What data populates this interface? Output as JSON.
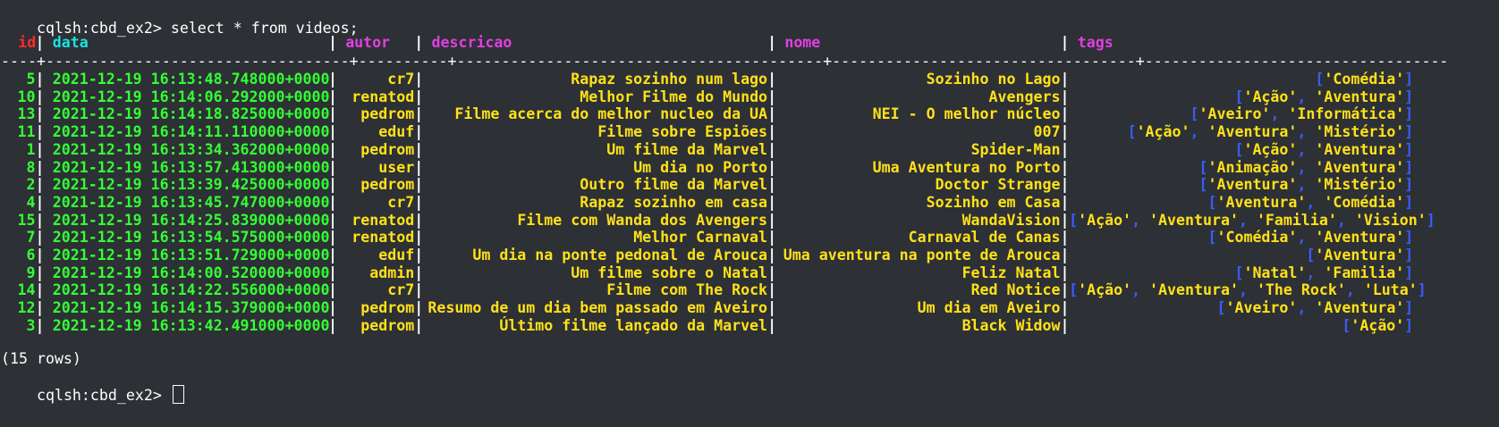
{
  "prompt": "cqlsh:cbd_ex2>",
  "command": " select * from videos;",
  "columns": [
    "id",
    "data",
    "autor",
    "descricao",
    "nome",
    "tags"
  ],
  "rows": [
    {
      "id": "5",
      "data": "2021-12-19 16:13:48.748000+0000",
      "autor": "cr7",
      "descricao": "Rapaz sozinho num lago",
      "nome": "Sozinho no Lago",
      "tags": [
        "Comédia"
      ]
    },
    {
      "id": "10",
      "data": "2021-12-19 16:14:06.292000+0000",
      "autor": "renatod",
      "descricao": "Melhor Filme do Mundo",
      "nome": "Avengers",
      "tags": [
        "Ação",
        "Aventura"
      ]
    },
    {
      "id": "13",
      "data": "2021-12-19 16:14:18.825000+0000",
      "autor": "pedrom",
      "descricao": "Filme acerca do melhor nucleo da UA",
      "nome": "NEI - O melhor núcleo",
      "tags": [
        "Aveiro",
        "Informática"
      ]
    },
    {
      "id": "11",
      "data": "2021-12-19 16:14:11.110000+0000",
      "autor": "eduf",
      "descricao": "Filme sobre Espiões",
      "nome": "007",
      "tags": [
        "Ação",
        "Aventura",
        "Mistério"
      ]
    },
    {
      "id": "1",
      "data": "2021-12-19 16:13:34.362000+0000",
      "autor": "pedrom",
      "descricao": "Um filme da Marvel",
      "nome": "Spider-Man",
      "tags": [
        "Ação",
        "Aventura"
      ]
    },
    {
      "id": "8",
      "data": "2021-12-19 16:13:57.413000+0000",
      "autor": "user",
      "descricao": "Um dia no Porto",
      "nome": "Uma Aventura no Porto",
      "tags": [
        "Animação",
        "Aventura"
      ]
    },
    {
      "id": "2",
      "data": "2021-12-19 16:13:39.425000+0000",
      "autor": "pedrom",
      "descricao": "Outro filme da Marvel",
      "nome": "Doctor Strange",
      "tags": [
        "Aventura",
        "Mistério"
      ]
    },
    {
      "id": "4",
      "data": "2021-12-19 16:13:45.747000+0000",
      "autor": "cr7",
      "descricao": "Rapaz sozinho em casa",
      "nome": "Sozinho em Casa",
      "tags": [
        "Aventura",
        "Comédia"
      ]
    },
    {
      "id": "15",
      "data": "2021-12-19 16:14:25.839000+0000",
      "autor": "renatod",
      "descricao": "Filme com Wanda dos Avengers",
      "nome": "WandaVision",
      "tags": [
        "Ação",
        "Aventura",
        "Familia",
        "Vision"
      ]
    },
    {
      "id": "7",
      "data": "2021-12-19 16:13:54.575000+0000",
      "autor": "renatod",
      "descricao": "Melhor Carnaval",
      "nome": "Carnaval de Canas",
      "tags": [
        "Comédia",
        "Aventura"
      ]
    },
    {
      "id": "6",
      "data": "2021-12-19 16:13:51.729000+0000",
      "autor": "eduf",
      "descricao": "Um dia na ponte pedonal de Arouca",
      "nome": "Uma aventura na ponte de Arouca",
      "tags": [
        "Aventura"
      ]
    },
    {
      "id": "9",
      "data": "2021-12-19 16:14:00.520000+0000",
      "autor": "admin",
      "descricao": "Um filme sobre o Natal",
      "nome": "Feliz Natal",
      "tags": [
        "Natal",
        "Familia"
      ]
    },
    {
      "id": "14",
      "data": "2021-12-19 16:14:22.556000+0000",
      "autor": "cr7",
      "descricao": "Filme com The Rock",
      "nome": "Red Notice",
      "tags": [
        "Ação",
        "Aventura",
        "The Rock",
        "Luta"
      ]
    },
    {
      "id": "12",
      "data": "2021-12-19 16:14:15.379000+0000",
      "autor": "pedrom",
      "descricao": "Resumo de um dia bem passado em Aveiro",
      "nome": "Um dia em Aveiro",
      "tags": [
        "Aveiro",
        "Aventura"
      ]
    },
    {
      "id": "3",
      "data": "2021-12-19 16:13:42.491000+0000",
      "autor": "pedrom",
      "descricao": "Último filme lançado da Marvel",
      "nome": "Black Widow",
      "tags": [
        "Ação"
      ]
    }
  ],
  "row_count": "(15 rows)",
  "prompt2": "cqlsh:cbd_ex2>",
  "colors": {
    "background": "#2d3035",
    "id_header": "#ff2b2b",
    "data_header": "#19e1e1",
    "other_header": "#e040e0",
    "number_value": "#33ff33",
    "text_value": "#ffe119",
    "bracket": "#3a5cff"
  }
}
